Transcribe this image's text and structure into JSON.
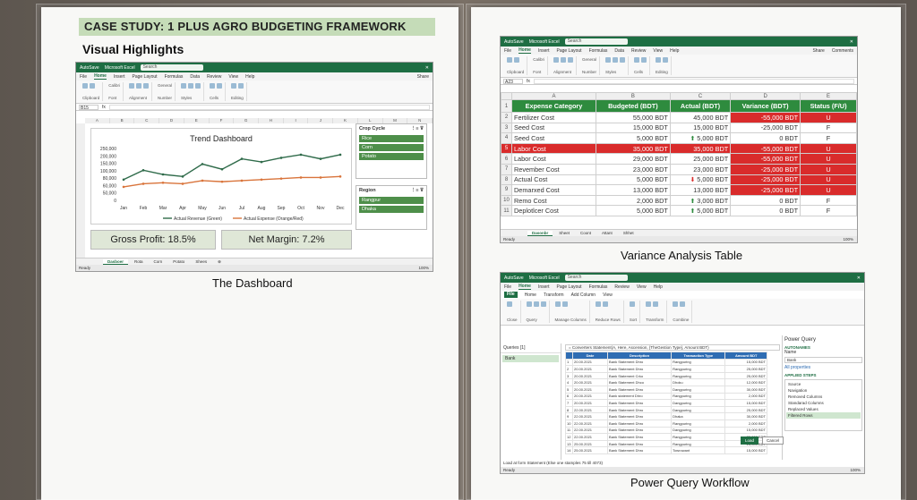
{
  "document": {
    "title": "CASE STUDY: 1 PLUS AGRO BUDGETING FRAMEWORK",
    "section_heading": "Visual Highlights"
  },
  "captions": {
    "dashboard": "The Dashboard",
    "variance": "Variance Analysis Table",
    "powerquery": "Power Query Workflow"
  },
  "colors": {
    "excel_green": "#1e6e43",
    "header_green": "#2e8b3e",
    "alert_red": "#d92b2b",
    "revenue_line": "#2f6b4a",
    "expense_line": "#d9743b"
  },
  "excel": {
    "app_name": "Microsoft Excel",
    "autosave": "AutoSave",
    "search": "Search",
    "menu": [
      "File",
      "Home",
      "Insert",
      "Page Layout",
      "Formulas",
      "Data",
      "Review",
      "View",
      "Help"
    ],
    "font_name": "Calibri",
    "number_format": "General",
    "share": "Share",
    "comments": "Comments",
    "ready": "Ready",
    "zoom": "100%"
  },
  "dashboard": {
    "cell_ref": "B15",
    "columns": [
      "A",
      "B",
      "C",
      "D",
      "E",
      "F",
      "G",
      "H",
      "I",
      "J",
      "K",
      "L",
      "M",
      "N"
    ],
    "chart_title": "Trend Dashboard",
    "kpi_gross": "Gross Profit: 18.5%",
    "kpi_net": "Net Margin: 7.2%",
    "slicer_crop": {
      "title": "Crop Cycle",
      "items": [
        "Rice",
        "Corn",
        "Potato"
      ]
    },
    "slicer_region": {
      "title": "Region",
      "items": [
        "Rangpur",
        "Dhaka"
      ]
    },
    "tabs": [
      "Dasboer",
      "Rota",
      "Corn",
      "Potato",
      "Shees"
    ],
    "legend_revenue": "Actual Revenue (Green)",
    "legend_expense": "Actual Expense (Orange/Red)"
  },
  "chart_data": {
    "type": "line",
    "title": "Trend Dashboard",
    "categories": [
      "Jan",
      "Feb",
      "Mar",
      "Apr",
      "May",
      "Jun",
      "Jul",
      "Aug",
      "Sep",
      "Oct",
      "Nov",
      "Dec"
    ],
    "series": [
      {
        "name": "Actual Revenue (Green)",
        "values": [
          100000,
          145000,
          125000,
          115000,
          175000,
          150000,
          200000,
          185000,
          205000,
          220000,
          200000,
          220000
        ]
      },
      {
        "name": "Actual Expense (Orange/Red)",
        "values": [
          65000,
          80000,
          85000,
          80000,
          95000,
          90000,
          95000,
          100000,
          105000,
          110000,
          110000,
          115000
        ]
      }
    ],
    "yticks": [
      "250,000",
      "200,000",
      "150,000",
      "100,000",
      "80,000",
      "60,000",
      "50,000",
      "0"
    ],
    "ylim": [
      0,
      250000
    ],
    "grid": false,
    "legend": "bottom"
  },
  "variance": {
    "cell_ref": "A23",
    "col_letters": [
      "A",
      "B",
      "C",
      "D",
      "E"
    ],
    "headers": [
      "Expense Category",
      "Budgeted (BDT)",
      "Actual (BDT)",
      "Variance (BDT)",
      "Status (F/U)"
    ],
    "rows": [
      {
        "n": "2",
        "cat": "Fertilizer Cost",
        "bud": "55,000 BDT",
        "act": "45,000 BDT",
        "var": "-55,000 BDT",
        "arrow": "",
        "st": "U",
        "vneg": true,
        "hl": false
      },
      {
        "n": "3",
        "cat": "Seed Cost",
        "bud": "15,000 BDT",
        "act": "15,000 BDT",
        "var": "-25,000 BDT",
        "arrow": "",
        "st": "F",
        "vneg": false,
        "hl": false
      },
      {
        "n": "4",
        "cat": "Seed Cost",
        "bud": "5,000 BDT",
        "act": "5,000 BDT",
        "var": "0 BDT",
        "arrow": "up",
        "st": "F",
        "vneg": false,
        "hl": false
      },
      {
        "n": "5",
        "cat": "Labor Cost",
        "bud": "35,000 BDT",
        "act": "35,000 BDT",
        "var": "-55,000 BDT",
        "arrow": "",
        "st": "U",
        "vneg": true,
        "hl": true
      },
      {
        "n": "6",
        "cat": "Labor Cost",
        "bud": "29,000 BDT",
        "act": "25,000 BDT",
        "var": "-55,000 BDT",
        "arrow": "",
        "st": "U",
        "vneg": true,
        "hl": false
      },
      {
        "n": "7",
        "cat": "Revember Cost",
        "bud": "23,000 BDT",
        "act": "23,000 BDT",
        "var": "-25,000 BDT",
        "arrow": "",
        "st": "U",
        "vneg": true,
        "hl": false
      },
      {
        "n": "8",
        "cat": "Actual Cost",
        "bud": "5,000 BDT",
        "act": "5,000 BDT",
        "var": "-25,000 BDT",
        "arrow": "down",
        "st": "U",
        "vneg": true,
        "hl": false
      },
      {
        "n": "9",
        "cat": "Demarxed Cost",
        "bud": "13,000 BDT",
        "act": "13,000 BDT",
        "var": "-25,000 BDT",
        "arrow": "",
        "st": "U",
        "vneg": true,
        "hl": false
      },
      {
        "n": "10",
        "cat": "Remo Cost",
        "bud": "2,000 BDT",
        "act": "3,000 BDT",
        "var": "0 BDT",
        "arrow": "up",
        "st": "F",
        "vneg": false,
        "hl": false
      },
      {
        "n": "11",
        "cat": "Deplotlcer Cost",
        "bud": "5,000 BDT",
        "act": "5,000 BDT",
        "var": "0 BDT",
        "arrow": "up",
        "st": "F",
        "vneg": false,
        "hl": false
      }
    ],
    "tabs": [
      "Dasonbr",
      "Sheet",
      "Coont",
      "Attant",
      "Shhet"
    ]
  },
  "powerquery": {
    "menu": [
      "File",
      "Home",
      "Transform",
      "Add Column",
      "View"
    ],
    "queries_title": "Queries [1]",
    "query_name": "Bank",
    "formula": "= Converters Statement(A, Here, Ascension, {TheGestion Type}, Amount BDT)",
    "grid_headers": [
      "Date",
      "Description",
      "Transaction Type",
      "Amount BDT"
    ],
    "grid_rows": [
      [
        "1",
        "20.00.2021",
        "Bank Statement Dhro",
        "Rangpuring",
        "15,000 BDT"
      ],
      [
        "2",
        "20.00.2021",
        "Bank Statement Dhro",
        "Rangpuring",
        "25,000 BDT"
      ],
      [
        "3",
        "20.00.2021",
        "Bank Statement Crko",
        "Rangpuring",
        "25,000 BDT"
      ],
      [
        "4",
        "20.00.2021",
        "Bank Statement Dhco",
        "Dhoku",
        "12,000 BDT"
      ],
      [
        "5",
        "20.00.2021",
        "Bank Statement Dhro",
        "Dangpuring",
        "30,000 BDT"
      ],
      [
        "6",
        "20.00.2021",
        "Bank statement Dhro",
        "Rangpuring",
        "2,000 BDT"
      ],
      [
        "7",
        "20.00.2021",
        "Bank Statement Dhro",
        "Dangpuring",
        "15,000 BDT"
      ],
      [
        "8",
        "22.00.2021",
        "Bank Statement Dhro",
        "Dangpuring",
        "25,000 BDT"
      ],
      [
        "9",
        "22.00.2021",
        "Bank Statement Dhro",
        "Dhaka",
        "30,000 BDT"
      ],
      [
        "10",
        "22.00.2021",
        "Bank Statement Dhro",
        "Rangpuring",
        "2,000 BDT"
      ],
      [
        "11",
        "22.00.2021",
        "Bank Statement Dhro",
        "Dangpuring",
        "15,000 BDT"
      ],
      [
        "12",
        "22.00.2021",
        "Bank Statement Dhro",
        "Rangpuring",
        "25,000 BDT"
      ],
      [
        "13",
        "25.00.2021",
        "Bank Statement Dhro",
        "Rangpuring",
        "25,000 BDT"
      ],
      [
        "14",
        "25.00.2021",
        "Bank Statement Dhro",
        "Towrowant",
        "15,000 BDT"
      ]
    ],
    "panel_title": "Power Query",
    "properties": "AUTONAMES",
    "name_label": "Name",
    "name_value": "Bank",
    "all_props": "All properties",
    "applied_steps": "APPLIED STEPS",
    "steps": [
      "Source",
      "Navigation",
      "Removed Columns",
      "Standarad Columns",
      "Replaced Values",
      "Filtered Rows"
    ],
    "load_btn": "Load",
    "cancel_btn": "Cancel",
    "status_text": "Load at form Statement (Else one stamples  75 till 4073)",
    "ready": "Ready"
  }
}
